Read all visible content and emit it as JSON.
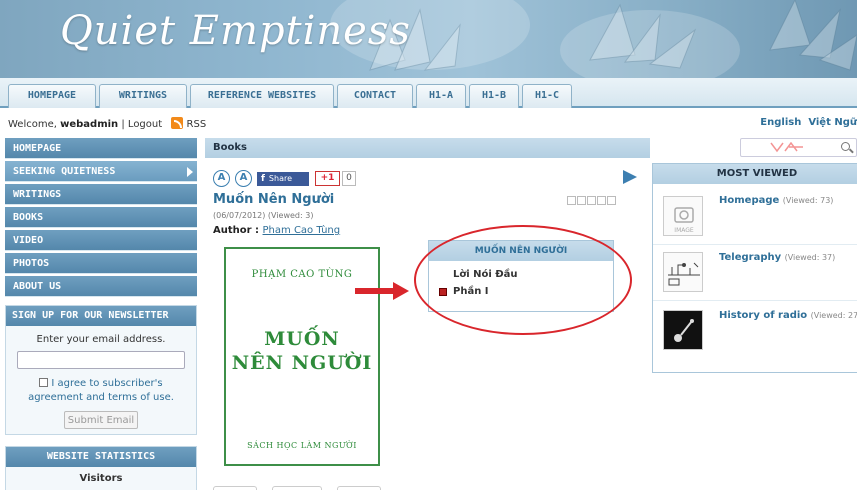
{
  "header": {
    "site_title": "Quiet Emptiness"
  },
  "tabs": [
    "HOMEPAGE",
    "WRITINGS",
    "REFERENCE WEBSITES",
    "CONTACT",
    "H1-A",
    "H1-B",
    "H1-C"
  ],
  "welcome": {
    "prefix": "Welcome, ",
    "user": "webadmin",
    "logout": "Logout",
    "rss": "RSS"
  },
  "languages": {
    "english": "English",
    "vietnamese": "Việt Ngữ"
  },
  "sidebar": {
    "items": [
      "HOMEPAGE",
      "SEEKING QUIETNESS",
      "WRITINGS",
      "BOOKS",
      "VIDEO",
      "PHOTOS",
      "ABOUT US"
    ],
    "active_item": "SEEKING QUIETNESS",
    "newsletter": {
      "title": "SIGN UP FOR OUR NEWSLETTER",
      "prompt": "Enter your email address.",
      "email_value": "",
      "agree_line1": "I agree to subscriber's",
      "agree_line2": "agreement and terms of use.",
      "submit": "Submit Email"
    },
    "stats": {
      "title": "WEBSITE STATISTICS",
      "visitors_label": "Visitors"
    }
  },
  "breadcrumb": "Books",
  "social": {
    "font_small": "A",
    "font_large": "A",
    "fb_logo": "f",
    "fb_share": "Share",
    "gplus": "+1",
    "gplus_count": "0"
  },
  "article": {
    "title": "Muốn Nên Người",
    "date": "(06/07/2012)",
    "viewed": "(Viewed: 3)",
    "author_label": "Author : ",
    "author_name": "Pham Cao Tùng",
    "rating": 0
  },
  "cover": {
    "author": "PHẠM CAO TÙNG",
    "title_line1": "MUỐN",
    "title_line2": "NÊN NGƯỜI",
    "subtitle": "SÁCH HỌC LÀM NGƯỜI"
  },
  "toc": {
    "title": "MUỐN NÊN NGƯỜI",
    "items": [
      "Lời Nói Đầu",
      "Phần I"
    ]
  },
  "most_viewed": {
    "title": "MOST VIEWED",
    "items": [
      {
        "title": "Homepage",
        "views": "(Viewed: 73)",
        "thumb_label": "IMAGE"
      },
      {
        "title": "Telegraphy",
        "views": "(Viewed: 37)"
      },
      {
        "title": "History of radio",
        "views": "(Viewed: 27)"
      }
    ]
  },
  "colors": {
    "accent": "#2f6f98",
    "nav_bg": "#5f93b6",
    "cover_green": "#2e8b3a",
    "highlight_red": "#d9262c"
  }
}
